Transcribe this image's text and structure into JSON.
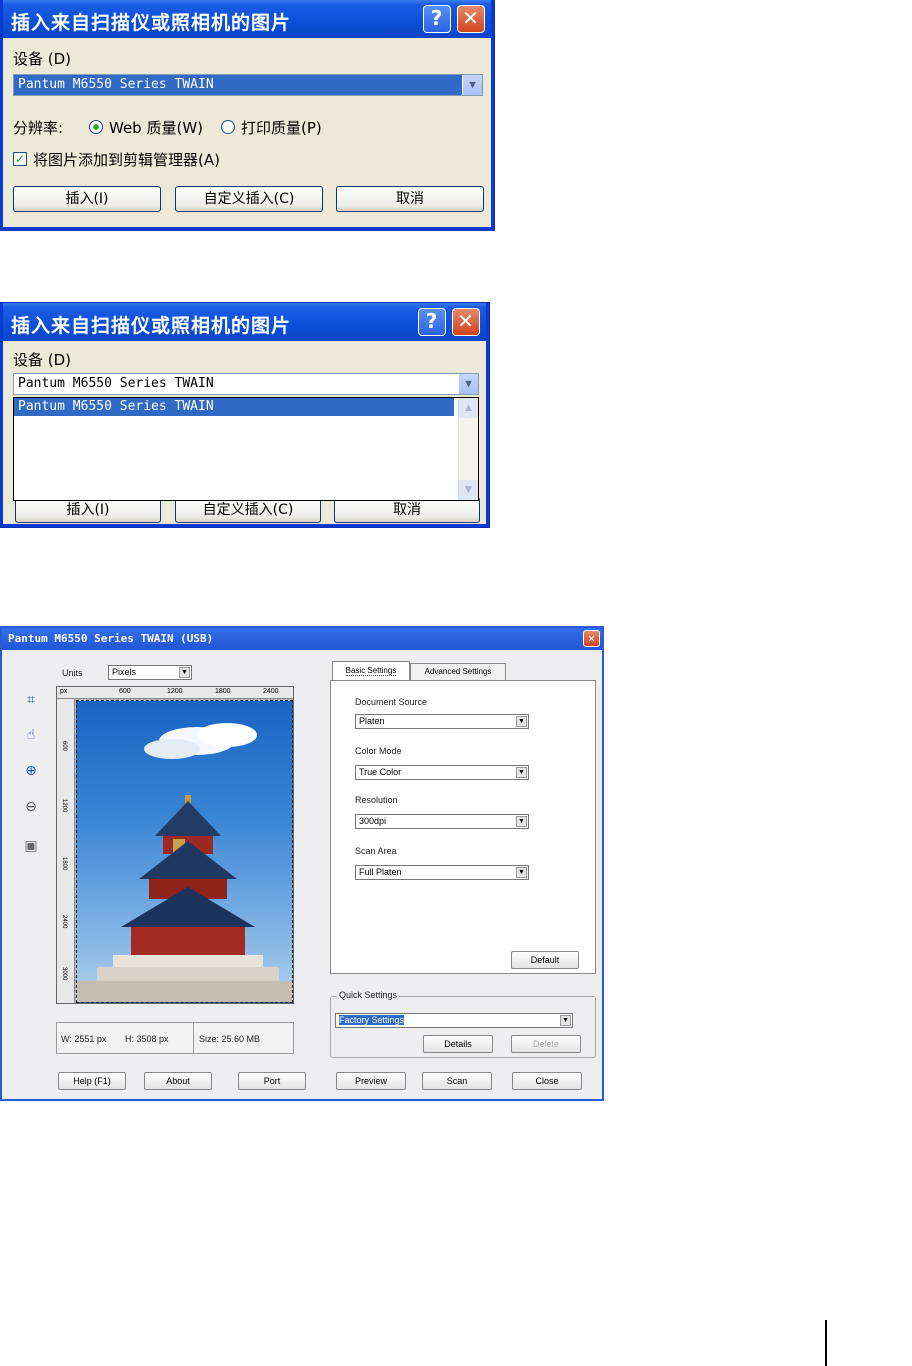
{
  "dialog1": {
    "title": "插入来自扫描仪或照相机的图片",
    "device_label": "设备 (D)",
    "device_value": "Pantum M6550 Series TWAIN",
    "resolution_label": "分辨率:",
    "web_quality": "Web 质量(W)",
    "print_quality": "打印质量(P)",
    "add_to_organizer": "将图片添加到剪辑管理器(A)",
    "insert_btn": "插入(I)",
    "custom_insert_btn": "自定义插入(C)",
    "cancel_btn": "取消"
  },
  "dialog2": {
    "title": "插入来自扫描仪或照相机的图片",
    "device_label": "设备 (D)",
    "device_value": "Pantum M6550 Series TWAIN",
    "list_item": "Pantum M6550 Series TWAIN",
    "btn1": "插入(I)",
    "btn2": "自定义插入(C)",
    "btn3": "取消"
  },
  "scanner": {
    "title": "Pantum M6550 Series TWAIN (USB)",
    "units_label": "Units",
    "units_value": "Pixels",
    "ruler_unit": "px",
    "ruler_ticks": [
      "600",
      "1200",
      "1800",
      "2400"
    ],
    "v_ticks": [
      "600",
      "1200",
      "1800",
      "2400",
      "3000"
    ],
    "width_text": "W: 2551 px",
    "height_text": "H: 3508 px",
    "size_text": "Size: 25.60 MB",
    "tabs": [
      "Basic Settings",
      "Advanced Settings"
    ],
    "document_source_label": "Document Source",
    "document_source_value": "Platen",
    "color_mode_label": "Color Mode",
    "color_mode_value": "True Color",
    "resolution_label": "Resolution",
    "resolution_value": "300dpi",
    "scan_area_label": "Scan Area",
    "scan_area_value": "Full Platen",
    "default_btn": "Default",
    "quick_settings_label": "Quick Settings",
    "quick_settings_value": "Factory Settings",
    "details_btn": "Details",
    "delete_btn": "Delete",
    "bottom_buttons": [
      "Help (F1)",
      "About",
      "Port",
      "Preview",
      "Scan",
      "Close"
    ]
  },
  "colors": {
    "xp_title": "#0e4fd8",
    "xp_body": "#ece9d8",
    "selection": "#316ac5"
  }
}
